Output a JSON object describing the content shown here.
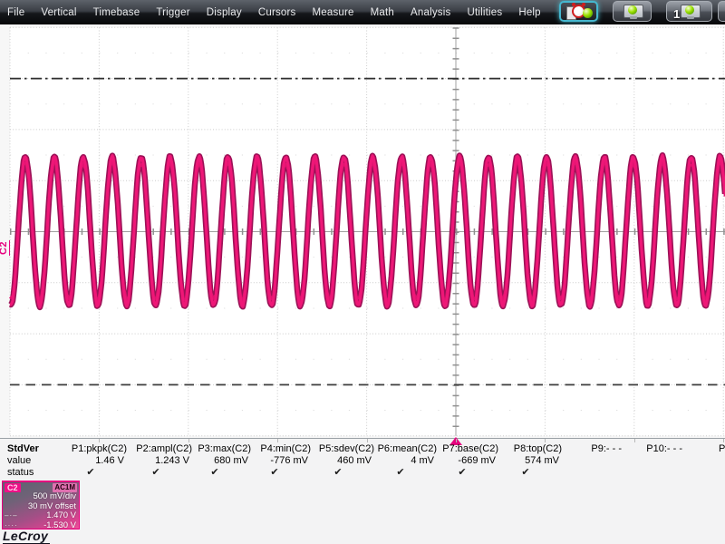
{
  "menu": {
    "items": [
      "File",
      "Vertical",
      "Timebase",
      "Trigger",
      "Display",
      "Cursors",
      "Measure",
      "Math",
      "Analysis",
      "Utilities",
      "Help"
    ]
  },
  "toolbar": {
    "clear_sweeps_label": "",
    "display_button_label": "",
    "display_button_numbered_label": "1"
  },
  "graticule": {
    "channel_tag": "C2",
    "trigger_position": "center"
  },
  "waveform": {
    "channel": "C2",
    "color": "#ee1777",
    "edge_color": "#9d1157",
    "volts_per_div": 0.5,
    "peak_to_peak_v": 1.46,
    "mean_v": 0.004,
    "cycles_visible": 24.7
  },
  "cursors": {
    "top": {
      "value": "1.470 V",
      "style": "dash-dot"
    },
    "bottom": {
      "value": "-1.530 V",
      "style": "dotted"
    }
  },
  "measurements": {
    "mode": "StdVer",
    "value_label": "value",
    "status_label": "status",
    "check_glyph": "✔",
    "clipped_label": "P",
    "params": [
      {
        "name": "P1:pkpk(C2)",
        "value": "1.46 V",
        "ok": true
      },
      {
        "name": "P2:ampl(C2)",
        "value": "1.243 V",
        "ok": true
      },
      {
        "name": "P3:max(C2)",
        "value": "680 mV",
        "ok": true
      },
      {
        "name": "P4:min(C2)",
        "value": "-776 mV",
        "ok": true
      },
      {
        "name": "P5:sdev(C2)",
        "value": "460 mV",
        "ok": true
      },
      {
        "name": "P6:mean(C2)",
        "value": "4 mV",
        "ok": true
      },
      {
        "name": "P7:base(C2)",
        "value": "-669 mV",
        "ok": true
      },
      {
        "name": "P8:top(C2)",
        "value": "574 mV",
        "ok": true
      },
      {
        "name": "P9:- - -",
        "value": "",
        "ok": false
      },
      {
        "name": "P10:- - -",
        "value": "",
        "ok": false
      }
    ]
  },
  "channel_box": {
    "channel": "C2",
    "coupling": "AC1M",
    "scale": "500 mV/div",
    "offset": "30 mV offset",
    "level1": "1.470 V",
    "level2": "-1.530 V",
    "accent": "#e6007e"
  },
  "logo": "LeCroy"
}
